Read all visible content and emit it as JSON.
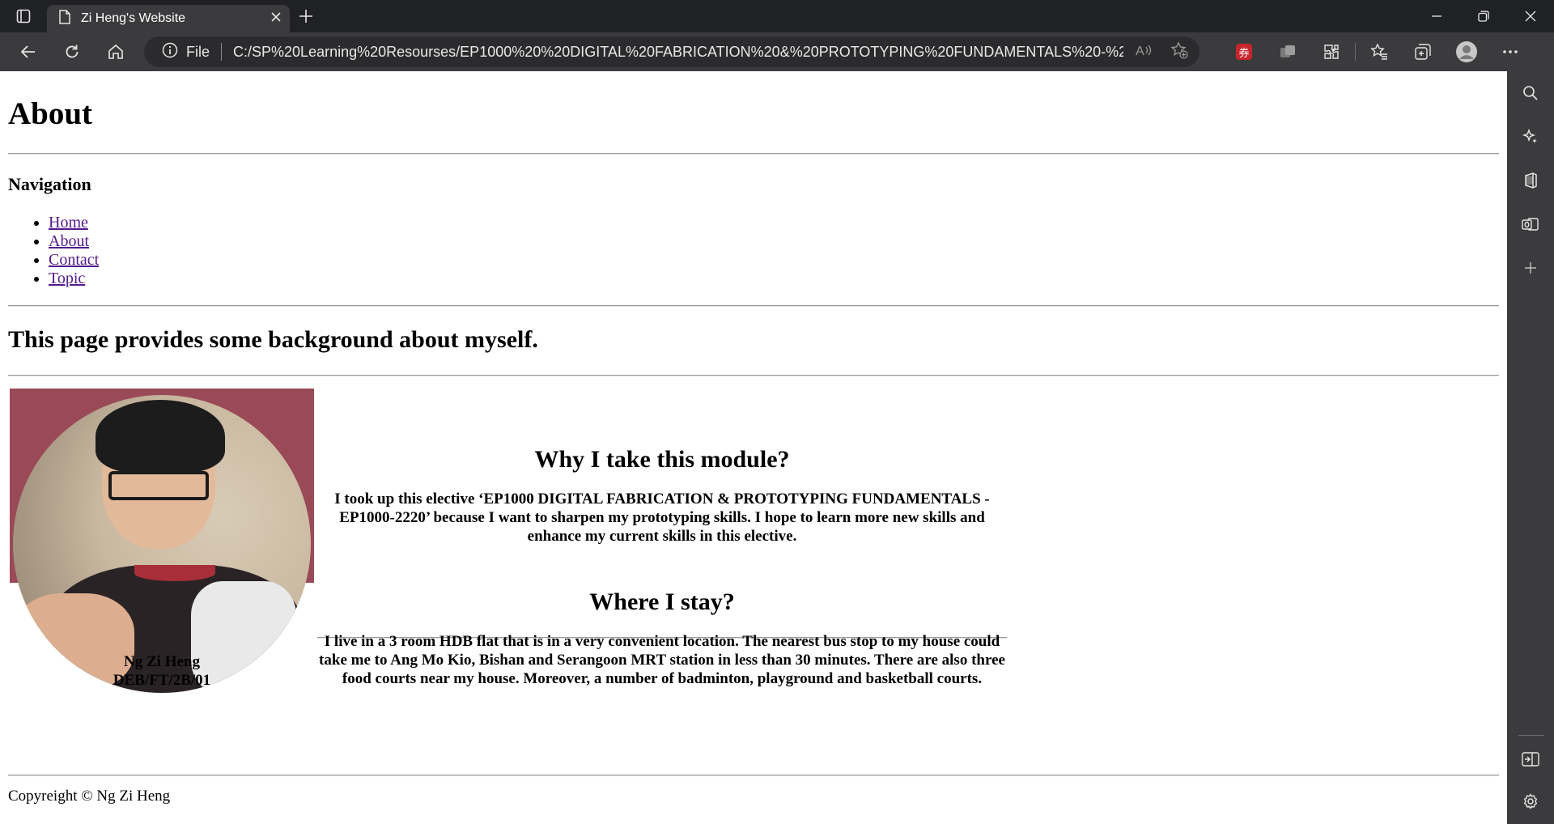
{
  "browser": {
    "tab_title": "Zi Heng's Website",
    "address_prefix": "File",
    "url": "C:/SP%20Learning%20Resourses/EP1000%20%20DIGITAL%20FABRICATION%20&%20PROTOTYPING%20FUNDAMENTALS%20-%20EP1000-222...",
    "icons": [
      "tab-actions-icon",
      "page-icon",
      "close-icon",
      "new-tab-icon",
      "minimize-icon",
      "restore-icon",
      "window-close-icon",
      "back-icon",
      "refresh-icon",
      "home-icon",
      "info-icon",
      "read-aloud-icon",
      "add-favorite-icon",
      "coupon-icon",
      "extension-icon",
      "extensions-icon",
      "favorites-icon",
      "collections-icon",
      "profile-icon",
      "more-icon"
    ],
    "coupon_glyph": "券"
  },
  "sidebar": {
    "icons": [
      "search-icon",
      "copilot-icon",
      "office-icon",
      "outlook-icon",
      "add-icon",
      "hide-sidebar-icon",
      "settings-icon"
    ]
  },
  "page": {
    "title": "About",
    "nav_heading": "Navigation",
    "nav_links": [
      "Home",
      "About",
      "Contact",
      "Topic"
    ],
    "intro": "This page provides some background about myself.",
    "caption_name": "Ng Zi Heng",
    "caption_class": "DEB/FT/2B/01",
    "section1_title": "Why I take this module?",
    "section1_text": "I took up this elective ‘EP1000 DIGITAL FABRICATION & PROTOTYPING FUNDAMENTALS - EP1000-2220’ because I want to sharpen my prototyping skills. I hope to learn more new skills and enhance my current skills in this elective.",
    "section2_title": "Where I stay?",
    "section2_text": "I live in a 3 room HDB flat that is in a very convenient location. The nearest bus stop to my house could take me to Ang Mo Kio, Bishan and Serangoon MRT station in less than 30 minutes. There are also three food courts near my house. Moreover, a number of badminton, playground and basketball courts.",
    "footer": "Copyreight © Ng Zi Heng"
  },
  "colors": {
    "chrome_dark": "#202124",
    "chrome": "#3b3b3d",
    "link_visited": "#551a8b",
    "photo_bg": "#9a4a56"
  }
}
